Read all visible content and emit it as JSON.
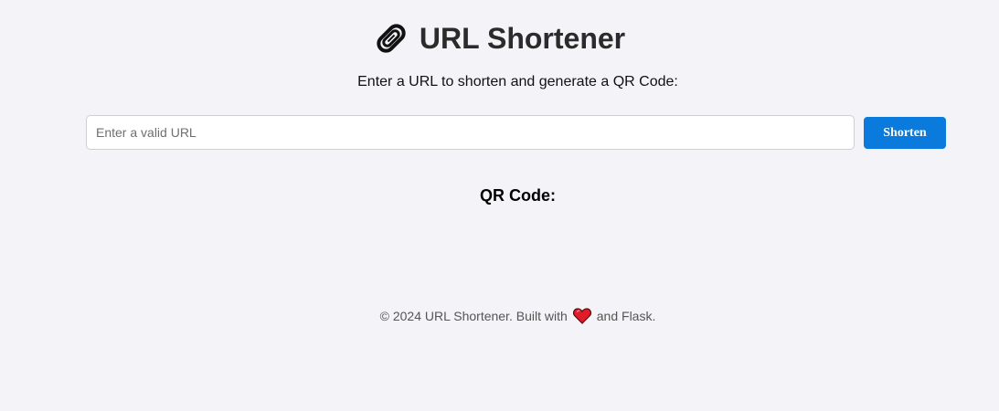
{
  "header": {
    "title": "URL Shortener",
    "logo_icon": "paperclip-link-icon"
  },
  "subtitle": "Enter a URL to shorten and generate a QR Code:",
  "form": {
    "url_input_placeholder": "Enter a valid URL",
    "url_input_value": "",
    "shorten_button_label": "Shorten"
  },
  "qr_section": {
    "heading": "QR Code:"
  },
  "footer": {
    "text_before": "© 2024 URL Shortener. Built with",
    "heart_icon": "red-heart-icon",
    "text_after": "and Flask."
  },
  "colors": {
    "background": "#f4f4f8",
    "accent": "#0a7bdc",
    "heart": "#e01b2a"
  }
}
